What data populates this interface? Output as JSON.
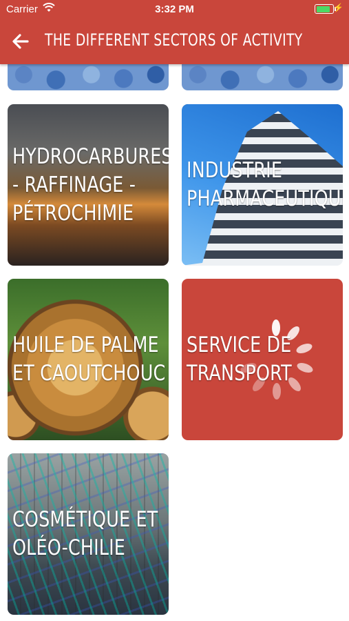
{
  "status_bar": {
    "carrier": "Carrier",
    "time": "3:32 PM"
  },
  "header": {
    "title": "THE DIFFERENT SECTORS OF ACTIVITY",
    "back_icon": "arrow-left-icon",
    "color": "#c9463b"
  },
  "sectors": [
    {
      "label": "HYDROCARBURES - RAFFINAGE - PÉTROCHIMIE"
    },
    {
      "label": "INDUSTRIE PHARMACEUTIQUE"
    },
    {
      "label": "HUILE DE PALME ET CAOUTCHOUC"
    },
    {
      "label": "SERVICE DE TRANSPORT",
      "loading": true
    },
    {
      "label": "COSMÉTIQUE ET OLÉO-CHILIE"
    }
  ]
}
